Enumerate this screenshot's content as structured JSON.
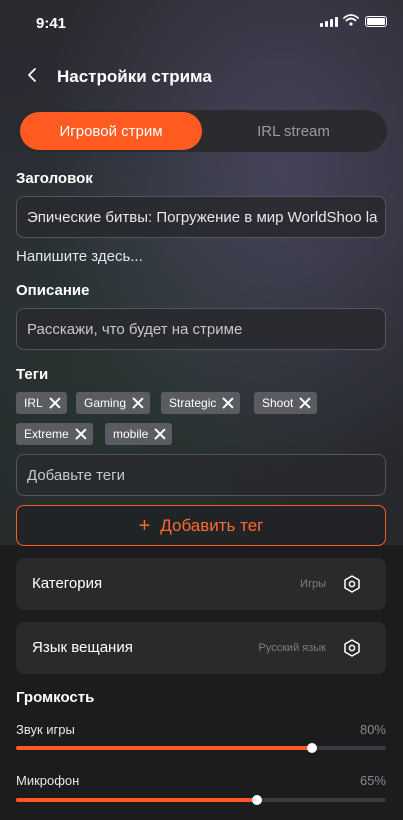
{
  "status": {
    "time": "9:41"
  },
  "header": {
    "title": "Настройки стрима"
  },
  "tabs": [
    {
      "label": "Игровой стрим",
      "active": true
    },
    {
      "label": "IRL stream",
      "active": false
    }
  ],
  "title_field": {
    "label": "Заголовок",
    "value": "Эпические битвы: Погружение в мир WorldShoo la",
    "hint": "Напишите здесь..."
  },
  "description_field": {
    "label": "Описание",
    "placeholder": "Расскажи, что будет на стриме"
  },
  "tags_section": {
    "label": "Теги",
    "tags": [
      "IRL",
      "Gaming",
      "Strategic",
      "Shoot",
      "Extreme",
      "mobile"
    ],
    "input_placeholder": "Добавьте теги",
    "add_button_label": "Добавить тег"
  },
  "category": {
    "label": "Категория",
    "value": "Игры"
  },
  "language": {
    "label": "Язык вещания",
    "value": "Русский язык"
  },
  "volume": {
    "title": "Громкость",
    "sliders": [
      {
        "label": "Звук игры",
        "value_label": "80%",
        "value": 0.8
      },
      {
        "label": "Микрофон",
        "value_label": "65%",
        "value": 0.65
      }
    ]
  },
  "colors": {
    "accent": "#ff5a1f",
    "background": "#1c1c1e"
  }
}
